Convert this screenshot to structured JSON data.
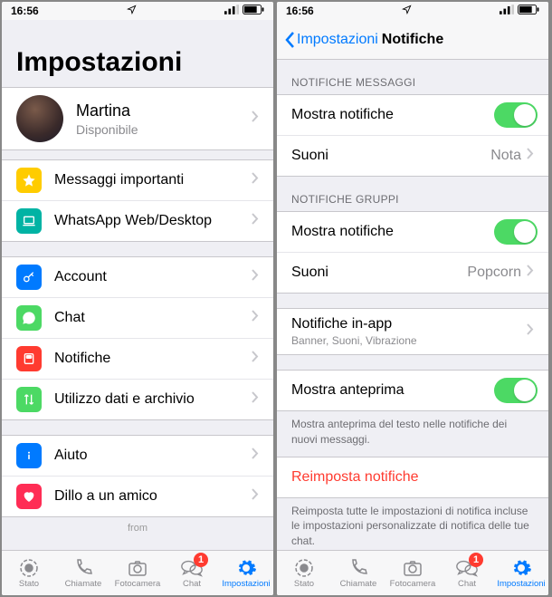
{
  "statusbar": {
    "time": "16:56"
  },
  "left": {
    "title": "Impostazioni",
    "profile": {
      "name": "Martina",
      "status": "Disponibile"
    },
    "group1": [
      {
        "label": "Messaggi importanti",
        "icon": "star",
        "color": "#ffcc00"
      },
      {
        "label": "WhatsApp Web/Desktop",
        "icon": "laptop",
        "color": "#00b3a4"
      }
    ],
    "group2": [
      {
        "label": "Account",
        "icon": "key",
        "color": "#007aff"
      },
      {
        "label": "Chat",
        "icon": "whatsapp",
        "color": "#4cd964"
      },
      {
        "label": "Notifiche",
        "icon": "notification",
        "color": "#ff3b30"
      },
      {
        "label": "Utilizzo dati e archivio",
        "icon": "arrows",
        "color": "#4cd964"
      }
    ],
    "group3": [
      {
        "label": "Aiuto",
        "icon": "info",
        "color": "#007aff"
      },
      {
        "label": "Dillo a un amico",
        "icon": "heart",
        "color": "#ff2d55"
      }
    ],
    "from": "from"
  },
  "right": {
    "back": "Impostazioni",
    "title": "Notifiche",
    "sections": {
      "messages": {
        "header": "NOTIFICHE MESSAGGI",
        "show": {
          "label": "Mostra notifiche",
          "on": true
        },
        "sounds": {
          "label": "Suoni",
          "value": "Nota"
        }
      },
      "groups": {
        "header": "NOTIFICHE GRUPPI",
        "show": {
          "label": "Mostra notifiche",
          "on": true
        },
        "sounds": {
          "label": "Suoni",
          "value": "Popcorn"
        }
      },
      "inapp": {
        "label": "Notifiche in-app",
        "sub": "Banner, Suoni, Vibrazione"
      },
      "preview": {
        "label": "Mostra anteprima",
        "on": true,
        "footer": "Mostra anteprima del testo nelle notifiche dei nuovi messaggi."
      },
      "reset": {
        "label": "Reimposta notifiche",
        "footer": "Reimposta tutte le impostazioni di notifica incluse le impostazioni personalizzate di notifica delle tue chat."
      }
    }
  },
  "tabs": {
    "items": [
      {
        "label": "Stato",
        "icon": "status"
      },
      {
        "label": "Chiamate",
        "icon": "calls"
      },
      {
        "label": "Fotocamera",
        "icon": "camera"
      },
      {
        "label": "Chat",
        "icon": "chat",
        "badge": "1"
      },
      {
        "label": "Impostazioni",
        "icon": "gear",
        "active": true
      }
    ]
  }
}
